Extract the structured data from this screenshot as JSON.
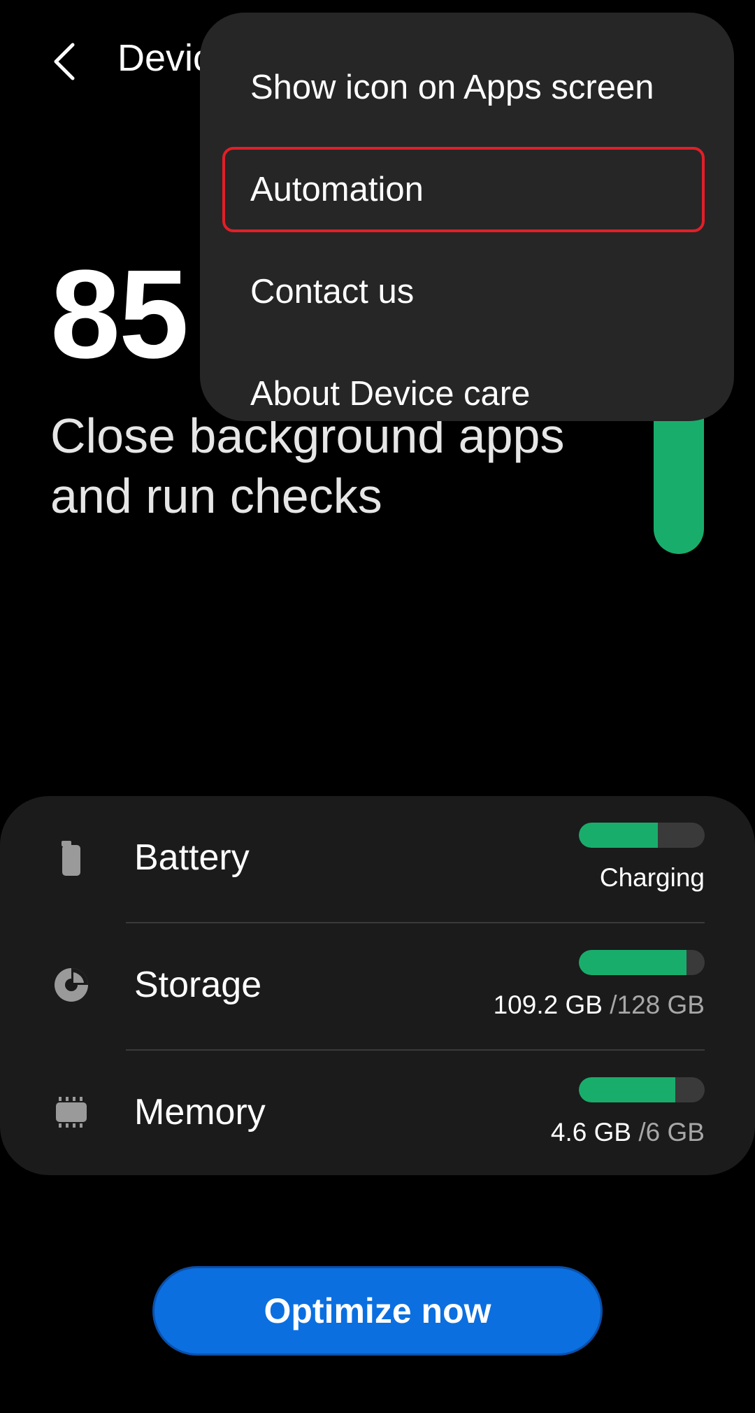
{
  "header": {
    "title": "Device care",
    "back_icon": "chevron-left-icon"
  },
  "score": {
    "value": "85",
    "message": "Close background apps and run checks",
    "bar_color": "#19ad6c"
  },
  "menu": {
    "items": [
      {
        "label": "Show icon on Apps screen"
      },
      {
        "label": "Automation",
        "highlighted": true
      },
      {
        "label": "Contact us"
      },
      {
        "label": "About Device care"
      }
    ]
  },
  "status": {
    "battery": {
      "label": "Battery",
      "value": "Charging",
      "fill_fraction": 0.63,
      "icon": "battery-icon"
    },
    "storage": {
      "label": "Storage",
      "used": "109.2 GB",
      "total": "/128 GB",
      "fill_fraction": 0.853,
      "icon": "storage-pie-icon"
    },
    "memory": {
      "label": "Memory",
      "used": "4.6 GB",
      "total": "/6 GB",
      "fill_fraction": 0.767,
      "icon": "memory-chip-icon"
    }
  },
  "actions": {
    "optimize_label": "Optimize now"
  },
  "colors": {
    "accent": "#0b6fe0",
    "good": "#19ad6c",
    "highlight_border": "#e11f28"
  }
}
